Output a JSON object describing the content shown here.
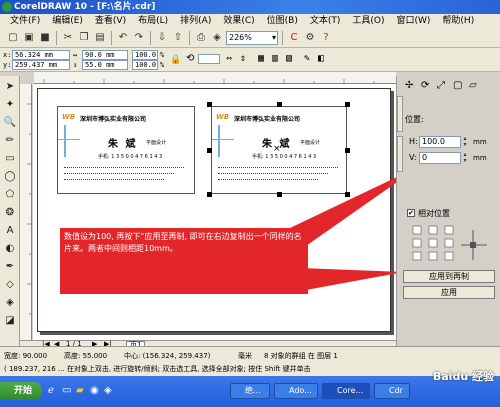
{
  "window": {
    "title": "CorelDRAW 10 - [F:\\名片.cdr]"
  },
  "menu": [
    "文件(F)",
    "编辑(E)",
    "查看(V)",
    "布局(L)",
    "排列(A)",
    "效果(C)",
    "位图(B)",
    "文本(T)",
    "工具(O)",
    "窗口(W)",
    "帮助(H)"
  ],
  "toolbar": {
    "zoom": "226%"
  },
  "propertybar": {
    "x": "56.324 mm",
    "y": "259.437 mm",
    "w": "90.0 mm",
    "h": "55.0 mm",
    "sx": "100.0",
    "sy": "100.0",
    "pct": "%"
  },
  "docker": {
    "position_label": "位置:",
    "h_label": "H:",
    "h_value": "100.0",
    "h_unit": "mm",
    "v_label": "V:",
    "v_value": "0",
    "v_unit": "mm",
    "relative_label": "相对位置",
    "apply_dup_button": "应用到再制",
    "apply_button": "应用"
  },
  "cards": [
    {
      "company": "深圳市博弘实业有限公司",
      "name": "朱 斌",
      "role": "平面设计",
      "phone": "手机: 1 3 5 0 0 4 7 6 1 4 3"
    },
    {
      "company": "深圳市博弘实业有限公司",
      "name": "朱 斌",
      "role": "平面设计",
      "phone": "手机: 1 3 5 0 0 4 7 6 1 4 3"
    }
  ],
  "callout": {
    "text": "数值设为100, 再按下“应用至再制, 即可在右边复制出一个同样的名片来。两者中间则相距10mm。"
  },
  "page_tabs": {
    "counter": "1 / 1",
    "page": "页1"
  },
  "status": {
    "line1_width": "宽度: 90.000",
    "line1_height": "高度: 55.000",
    "line1_center": "中心: (156.324, 259.437)",
    "line1_unit": "毫米",
    "line1_objects": "8 对象的群组 在 图层 1",
    "line2": "( 189.237, 216 ...  在对象上双击, 进行旋转/倾斜; 双击选工具, 选择全部对象; 按住 Shift 键并单击"
  },
  "taskbar": {
    "start": "开始",
    "tasks": [
      "绝...",
      "Ado...",
      "Core...",
      "Cdr"
    ]
  },
  "watermark": "Baidu 经验"
}
